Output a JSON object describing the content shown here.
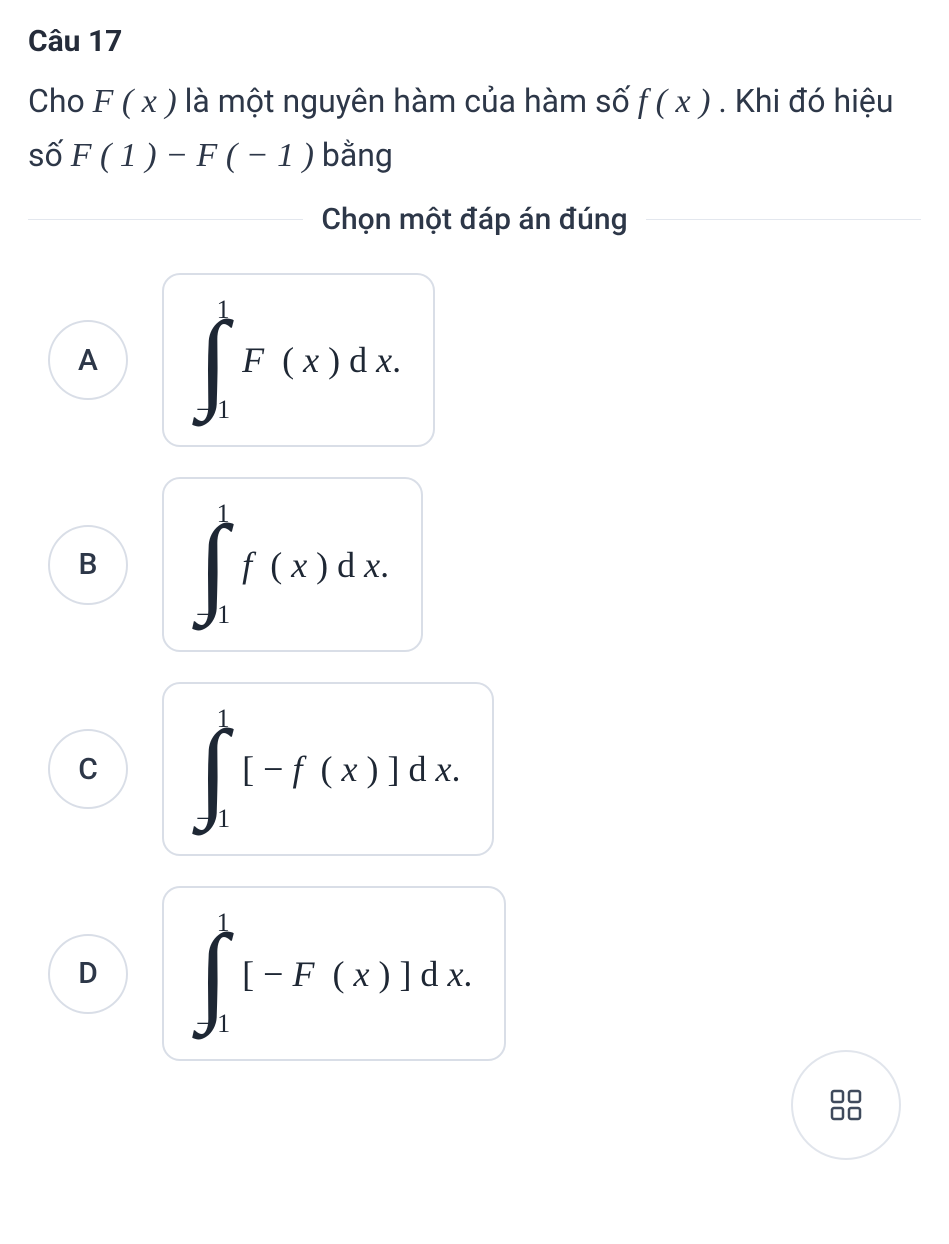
{
  "question": {
    "title": "Câu 17",
    "text_before_F": "Cho ",
    "F_of_x": "F ( x )",
    "text_mid1": " là một nguyên hàm của hàm số ",
    "f_of_x": "f ( x )",
    "text_mid2": " . Khi đó hiệu số ",
    "diff_expr": "F ( 1 ) − F ( − 1 )",
    "text_after": " bằng"
  },
  "instruction": "Chọn một đáp án đúng",
  "integral_upper": "1",
  "integral_lower": "− 1",
  "options": [
    {
      "letter": "A",
      "integrand_func": "F",
      "integrand_prefix": "",
      "integrand_suffix": "( x ) d x.",
      "bracket": false
    },
    {
      "letter": "B",
      "integrand_func": "f",
      "integrand_prefix": "",
      "integrand_suffix": "( x ) d x.",
      "bracket": false
    },
    {
      "letter": "C",
      "integrand_func": "f",
      "integrand_prefix": "[ − ",
      "integrand_suffix": "( x ) ] d x.",
      "bracket": true
    },
    {
      "letter": "D",
      "integrand_func": "F",
      "integrand_prefix": "[ − ",
      "integrand_suffix": "( x ) ] d x.",
      "bracket": true
    }
  ],
  "icons": {
    "grid": "grid-icon"
  }
}
